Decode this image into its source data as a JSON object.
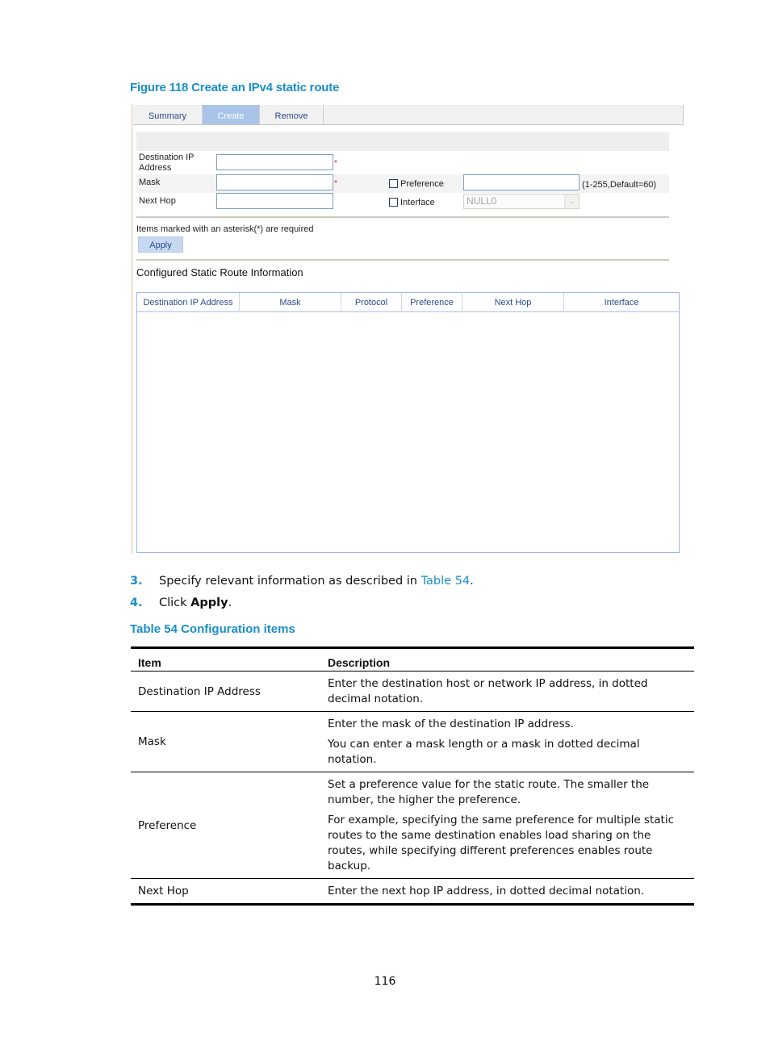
{
  "figure": {
    "caption": "Figure 118 Create an IPv4 static route",
    "tabs": [
      {
        "label": "Summary",
        "active": false
      },
      {
        "label": "Create",
        "active": true
      },
      {
        "label": "Remove",
        "active": false
      }
    ],
    "form": {
      "destination_ip": {
        "label": "Destination IP Address",
        "label_line1": "Destination IP",
        "label_line2": "Address",
        "value": "",
        "required_mark": "*"
      },
      "mask": {
        "label": "Mask",
        "value": "",
        "required_mark": "*"
      },
      "next_hop": {
        "label": "Next Hop",
        "value": ""
      },
      "preference": {
        "label": "Preference",
        "checked": false,
        "value": "",
        "hint": "(1-255,Default=60)"
      },
      "interface": {
        "label": "Interface",
        "checked": false,
        "selected": "NULL0",
        "disabled": true
      }
    },
    "required_note": "Items marked with an asterisk(*) are required",
    "apply_label": "Apply",
    "section_title": "Configured Static Route Information",
    "grid_columns": [
      "Destination IP Address",
      "Mask",
      "Protocol",
      "Preference",
      "Next Hop",
      "Interface"
    ],
    "grid_rows": []
  },
  "steps": [
    {
      "num": "3.",
      "text_before": "Specify relevant information as described in ",
      "link": "Table 54",
      "text_after": "."
    },
    {
      "num": "4.",
      "text_before": "Click ",
      "bold": "Apply",
      "text_after": "."
    }
  ],
  "table": {
    "caption": "Table 54 Configuration items",
    "headers": [
      "Item",
      "Description"
    ],
    "rows": [
      {
        "item": "Destination IP Address",
        "desc": [
          "Enter the destination host or network IP address, in dotted decimal notation."
        ]
      },
      {
        "item": "Mask",
        "desc": [
          "Enter the mask of the destination IP address.",
          "You can enter a mask length or a mask in dotted decimal notation."
        ]
      },
      {
        "item": "Preference",
        "desc": [
          "Set a preference value for the static route. The smaller the number, the higher the preference.",
          "For example, specifying the same preference for multiple static routes to the same destination enables load sharing on the routes, while specifying different preferences enables route backup."
        ]
      },
      {
        "item": "Next Hop",
        "desc": [
          "Enter the next hop IP address, in dotted decimal notation."
        ]
      }
    ]
  },
  "page_number": "116",
  "colors": {
    "accent": "#1a8fc8",
    "tab_active": "#a9c4e8",
    "required": "#d81b3c",
    "grid_border": "#9db9e0"
  }
}
